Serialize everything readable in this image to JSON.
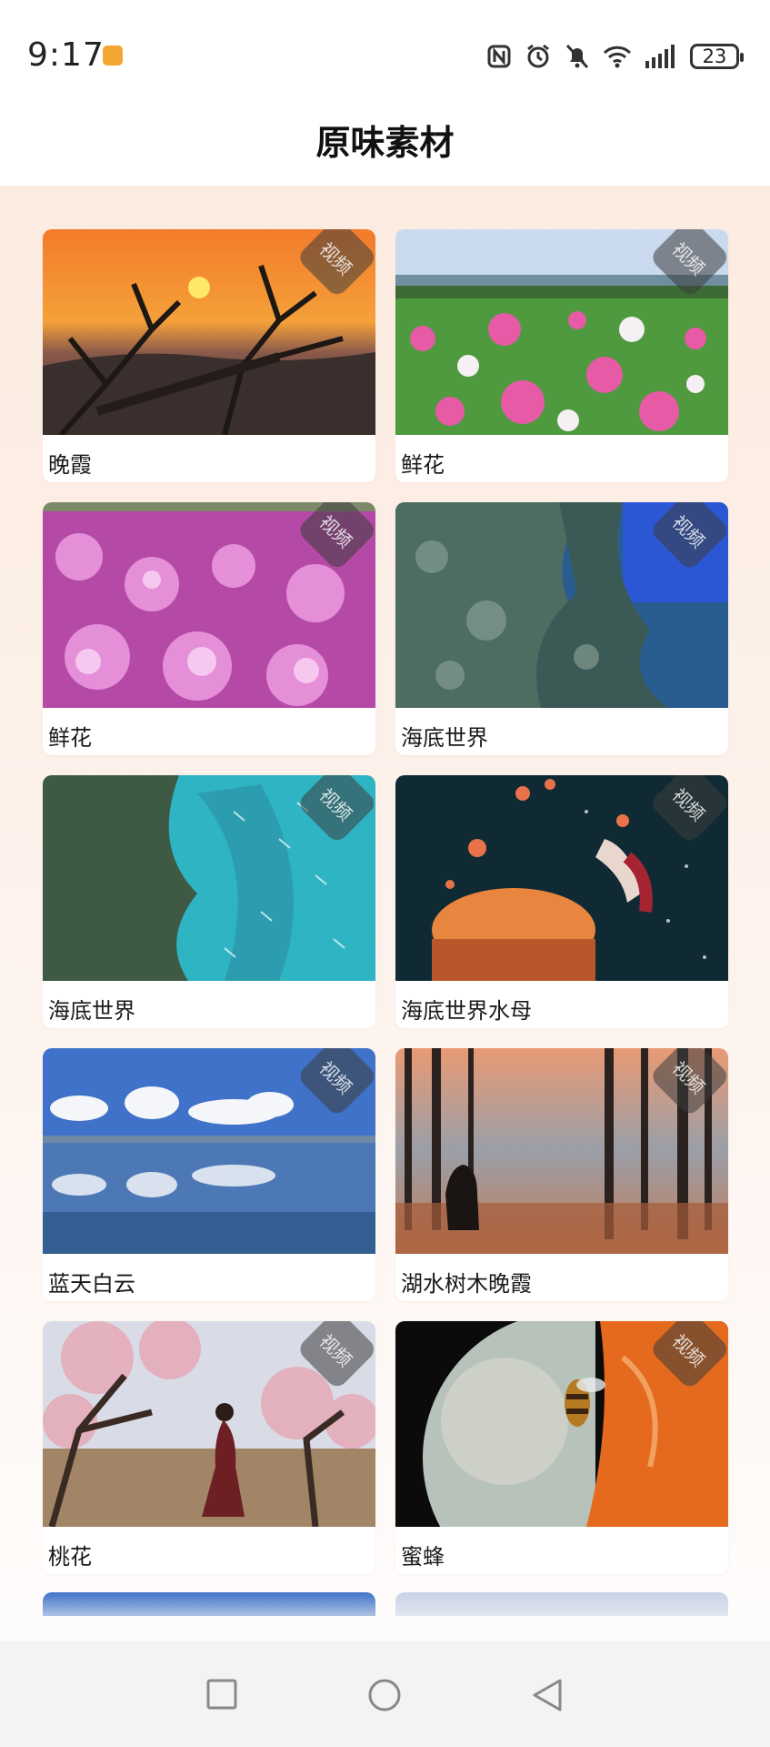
{
  "status_bar": {
    "time": "9:17",
    "battery": "23",
    "icons": [
      "nfc-icon",
      "alarm-icon",
      "mute-icon",
      "wifi-icon",
      "signal-icon",
      "battery-icon"
    ]
  },
  "header": {
    "title": "原味素材"
  },
  "badge_label": "视频",
  "materials": [
    {
      "label": "晚霞",
      "badge": "视频"
    },
    {
      "label": "鲜花",
      "badge": "视频"
    },
    {
      "label": "鲜花",
      "badge": "视频"
    },
    {
      "label": "海底世界",
      "badge": "视频"
    },
    {
      "label": "海底世界",
      "badge": "视频"
    },
    {
      "label": "海底世界水母",
      "badge": "视频"
    },
    {
      "label": "蓝天白云",
      "badge": "视频"
    },
    {
      "label": "湖水树木晚霞",
      "badge": "视频"
    },
    {
      "label": "桃花",
      "badge": "视频"
    },
    {
      "label": "蜜蜂",
      "badge": "视频"
    }
  ],
  "nav_bar": {
    "buttons": [
      "recent-apps-button",
      "home-button",
      "back-button"
    ]
  }
}
